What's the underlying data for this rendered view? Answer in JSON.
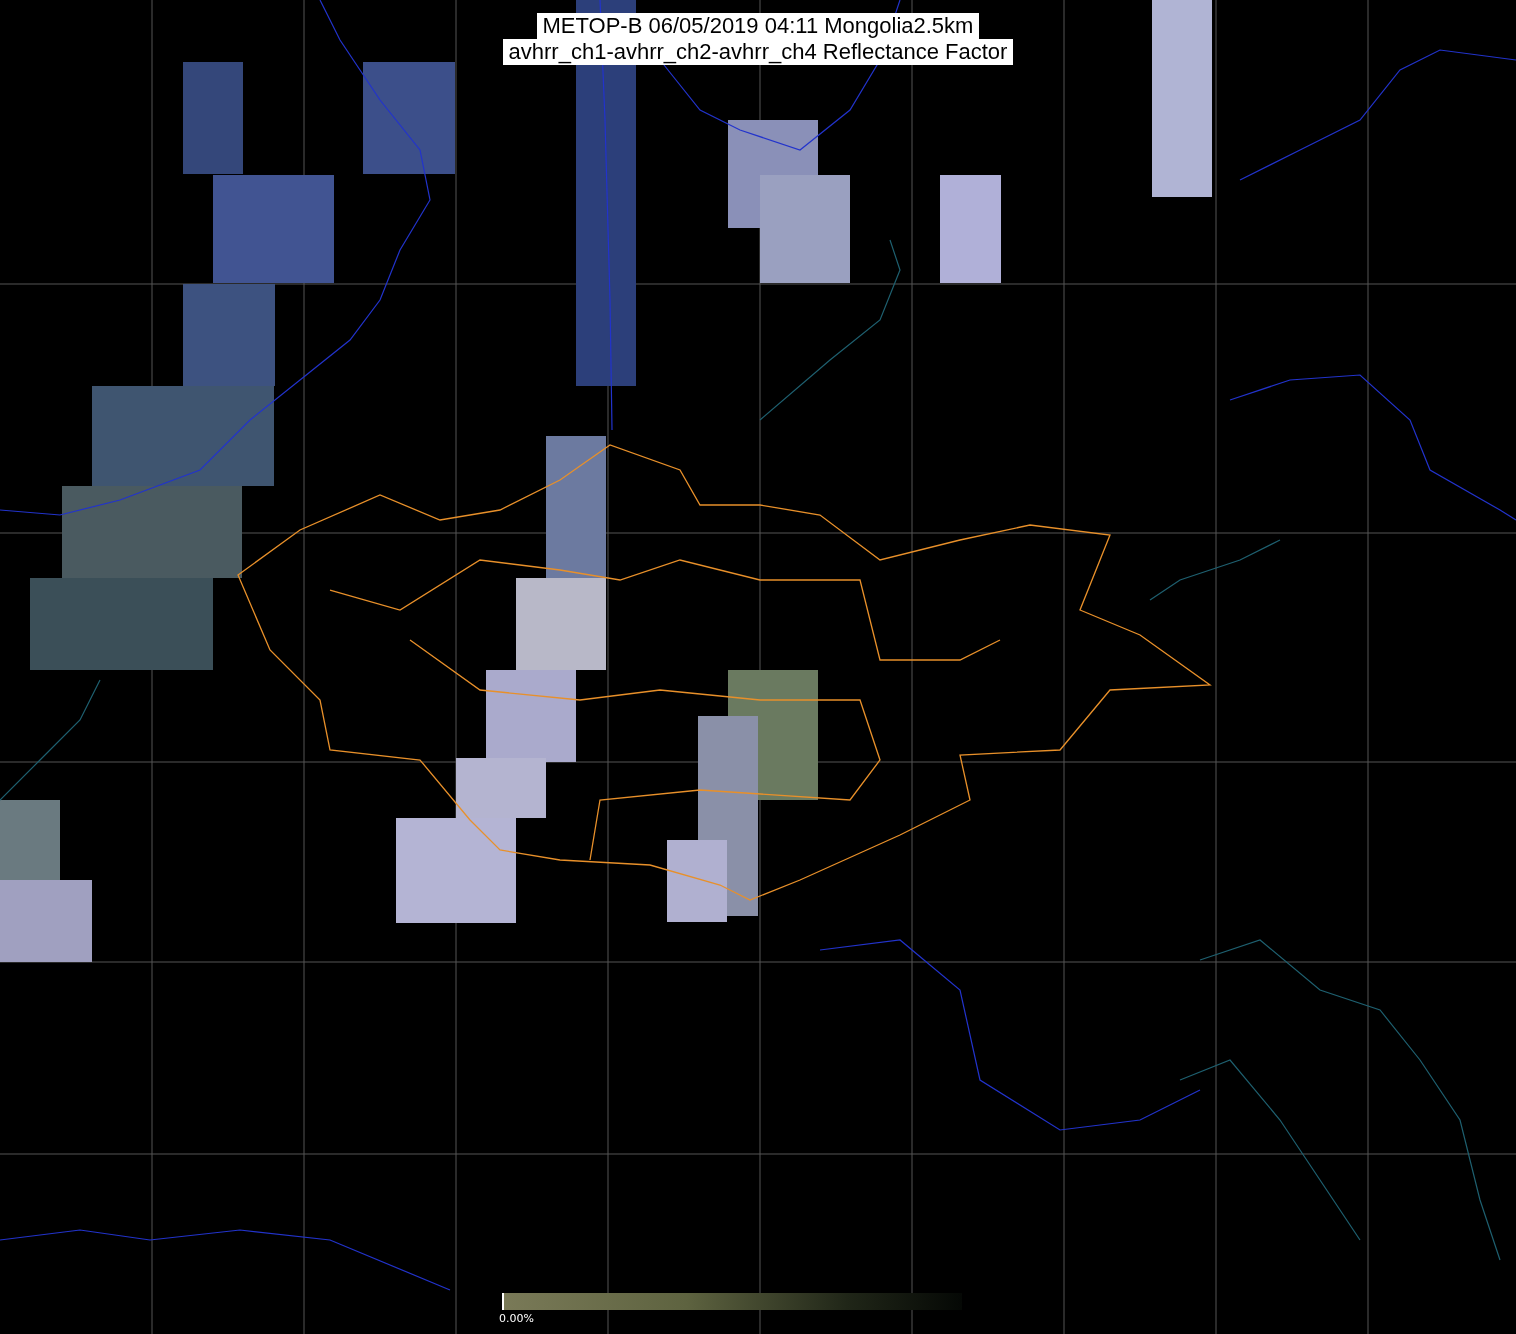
{
  "title": {
    "lines": [
      "METOP-B 06/05/2019 04:11 Mongolia2.5km",
      "avhrr_ch1-avhrr_ch2-avhrr_ch4 Reflectance Factor"
    ]
  },
  "colorbar": {
    "label": "0.00%",
    "level": 0.0
  }
}
